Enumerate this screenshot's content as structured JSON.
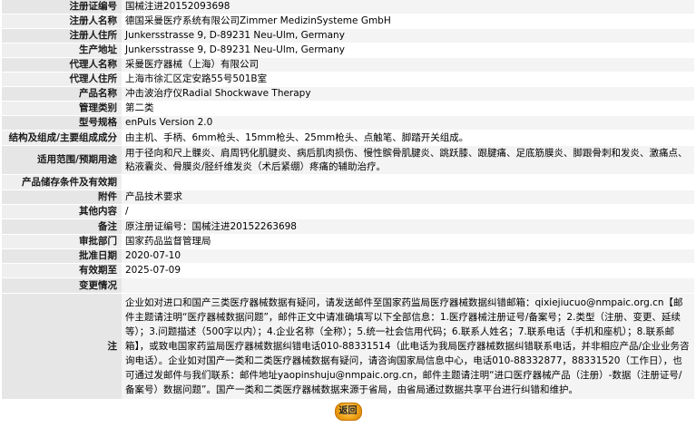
{
  "rows": [
    {
      "label": "注册证编号",
      "value": "国械注进20152093698"
    },
    {
      "label": "注册人名称",
      "value": "德国采曼医疗系统有限公司Zimmer MedizinSysteme GmbH"
    },
    {
      "label": "注册人住所",
      "value": "Junkersstrasse 9, D-89231 Neu-Ulm, Germany"
    },
    {
      "label": "生产地址",
      "value": "Junkersstrasse 9, D-89231 Neu-Ulm, Germany"
    },
    {
      "label": "代理人名称",
      "value": "采曼医疗器械（上海）有限公司"
    },
    {
      "label": "代理人住所",
      "value": "上海市徐汇区定安路55号501B室"
    },
    {
      "label": "产品名称",
      "value": "冲击波治疗仪Radial Shockwave Therapy"
    },
    {
      "label": "管理类别",
      "value": "第二类"
    },
    {
      "label": "型号规格",
      "value": "enPuls Version 2.0"
    },
    {
      "label": "结构及组成/主要组成成分",
      "value": "由主机、手柄、6mm枪头、15mm枪头、25mm枪头、点触笔、脚踏开关组成。"
    },
    {
      "label": "适用范围/预期用途",
      "value": "用于径向和尺上髁炎、肩周钙化肌腱炎、病后肌肉损伤、慢性髌骨肌腱炎、跳跃膝、跟腱痛、足底筋膜炎、脚跟骨刺和发炎、激痛点、粘液囊炎、骨膜炎/胫纤维发炎（术后紧绷）疼痛的辅助治疗。"
    },
    {
      "label": "产品储存条件及有效期",
      "value": ""
    },
    {
      "label": "附件",
      "value": "产品技术要求"
    },
    {
      "label": "其他内容",
      "value": "/"
    },
    {
      "label": "备注",
      "value": "原注册证编号：国械注进20152263698"
    },
    {
      "label": "审批部门",
      "value": "国家药品监督管理局"
    },
    {
      "label": "批准日期",
      "value": "2020-07-10"
    },
    {
      "label": "有效期至",
      "value": "2025-07-09"
    },
    {
      "label": "变更情况",
      "value": ""
    }
  ],
  "note": {
    "label": "注",
    "text": "企业如对进口和国产三类医疗器械数据有疑问，请发送邮件至国家药监局医疗器械数据纠错邮箱：qixiejiucuo@nmpaic.org.cn【邮件主题请注明“医疗器械数据问题”，邮件正文中请准确填写以下全部信息：1.医疗器械注册证号/备案号；2.类型（注册、变更、延续等）；3.问题描述（500字以内）；4.企业名称（全称）；5.统一社会信用代码；6.联系人姓名；7.联系电话（手机和座机）；8.联系邮箱】，或致电国家药监局医疗器械数据纠错电话010-88331514（此电话为我局医疗器械数据纠错联系电话，并非相应产品/企业业务咨询电话）。企业如对国产一类和二类医疗器械数据有疑问，请咨询国家局信息中心，电话010-88332877，88331520（工作日），也可通过发邮件与我们联系：邮件地址yaopinshuju@nmpaic.org.cn，邮件主题请注明“进口医疗器械产品（注册）-数据（注册证号/备案号）数据问题”。国产一类和二类医疗器械数据来源于省局，由省局通过数据共享平台进行纠错和维护。"
  },
  "back_button": {
    "label": "返回"
  }
}
